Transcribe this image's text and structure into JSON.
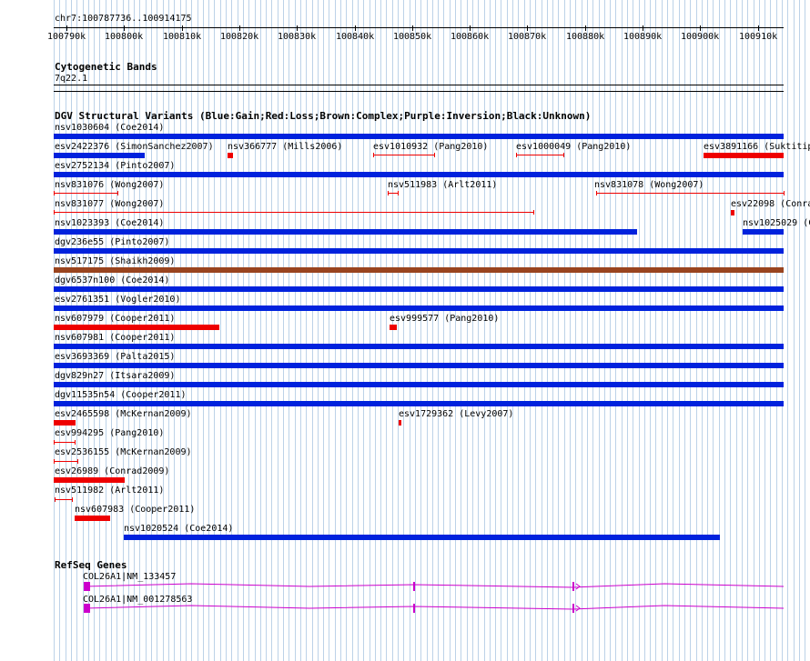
{
  "ruler": {
    "position": "chr7:100787736..100914175",
    "ticks": [
      "100790k",
      "100800k",
      "100810k",
      "100820k",
      "100830k",
      "100840k",
      "100850k",
      "100860k",
      "100870k",
      "100880k",
      "100890k",
      "100900k",
      "100910k"
    ]
  },
  "cytobands": {
    "title": "Cytogenetic Bands",
    "band": "7q22.1"
  },
  "dgv": {
    "title": "DGV Structural Variants (Blue:Gain;Red:Loss;Brown:Complex;Purple:Inversion;Black:Unknown)",
    "colors": {
      "gain": "#0022dd",
      "loss": "#ee0000",
      "complex": "#99441f"
    },
    "features": [
      {
        "label": "nsv1030604 (Coe2014)",
        "type": "gain"
      },
      {
        "label": "esv2422376 (SimonSanchez2007)",
        "type": "gain"
      },
      {
        "label": "nsv366777 (Mills2006)",
        "type": "loss"
      },
      {
        "label": "esv1010932 (Pang2010)",
        "type": "loss"
      },
      {
        "label": "esv1000049 (Pang2010)",
        "type": "loss"
      },
      {
        "label": "esv3891166 (Suktitip",
        "type": "loss"
      },
      {
        "label": "esv2752134 (Pinto2007)",
        "type": "gain"
      },
      {
        "label": "nsv831076 (Wong2007)",
        "type": "loss"
      },
      {
        "label": "nsv511983 (Arlt2011)",
        "type": "loss"
      },
      {
        "label": "nsv831078 (Wong2007)",
        "type": "loss"
      },
      {
        "label": "nsv831077 (Wong2007)",
        "type": "loss"
      },
      {
        "label": "esv22098 (Conra",
        "type": "loss"
      },
      {
        "label": "nsv1023393 (Coe2014)",
        "type": "gain"
      },
      {
        "label": "nsv1025029 (C",
        "type": "gain"
      },
      {
        "label": "dgv236e55 (Pinto2007)",
        "type": "gain"
      },
      {
        "label": "nsv517175 (Shaikh2009)",
        "type": "complex"
      },
      {
        "label": "dgv6537n100 (Coe2014)",
        "type": "gain"
      },
      {
        "label": "esv2761351 (Vogler2010)",
        "type": "gain"
      },
      {
        "label": "nsv607979 (Cooper2011)",
        "type": "loss"
      },
      {
        "label": "esv999577 (Pang2010)",
        "type": "loss"
      },
      {
        "label": "nsv607981 (Cooper2011)",
        "type": "gain"
      },
      {
        "label": "esv3693369 (Palta2015)",
        "type": "gain"
      },
      {
        "label": "dgv829n27 (Itsara2009)",
        "type": "gain"
      },
      {
        "label": "dgv11535n54 (Cooper2011)",
        "type": "gain"
      },
      {
        "label": "esv2465598 (McKernan2009)",
        "type": "loss"
      },
      {
        "label": "esv1729362 (Levy2007)",
        "type": "loss"
      },
      {
        "label": "esv994295 (Pang2010)",
        "type": "loss"
      },
      {
        "label": "esv2536155 (McKernan2009)",
        "type": "loss"
      },
      {
        "label": "esv26989 (Conrad2009)",
        "type": "loss"
      },
      {
        "label": "nsv511982 (Arlt2011)",
        "type": "loss"
      },
      {
        "label": "nsv607983 (Cooper2011)",
        "type": "loss"
      },
      {
        "label": "nsv1020524 (Coe2014)",
        "type": "gain"
      }
    ]
  },
  "refseq": {
    "title": "RefSeq Genes",
    "color": "#cc00cc",
    "genes": [
      {
        "label": "COL26A1|NM_133457"
      },
      {
        "label": "COL26A1|NM_001278563"
      }
    ]
  }
}
